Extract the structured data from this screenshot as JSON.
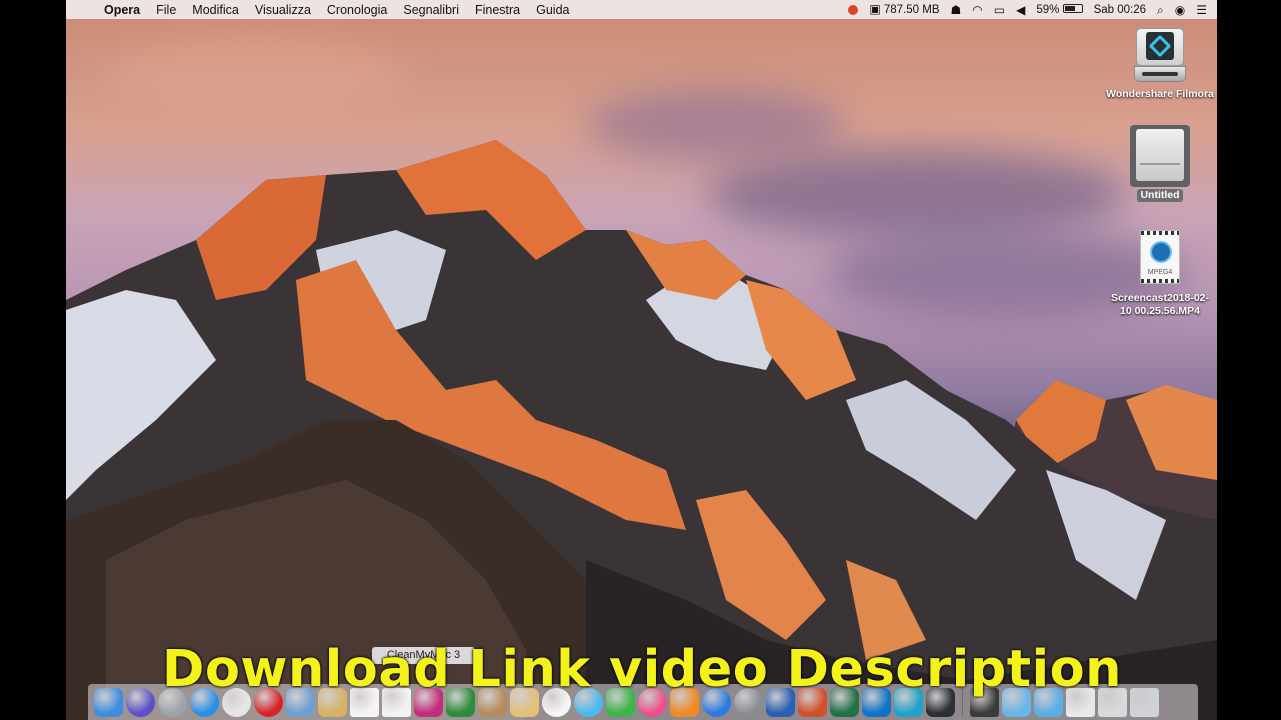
{
  "menubar": {
    "app_name": "Opera",
    "items": [
      "File",
      "Modifica",
      "Visualizza",
      "Cronologia",
      "Segnalibri",
      "Finestra",
      "Guida"
    ],
    "memory": "787.50 MB",
    "battery_percent": "59%",
    "clock": "Sab 00:26"
  },
  "desktop_icons": [
    {
      "label": "Wondershare Filmora",
      "icon": "filmora-drive-icon"
    },
    {
      "label": "Untitled",
      "icon": "external-drive-icon"
    },
    {
      "label": "Screencast2018-02-10 00.25.56.MP4",
      "icon": "mpeg4-file-icon",
      "badge": "MPEG4"
    }
  ],
  "tooltip": "CleanMyMac 3",
  "caption": "Download Link video Description",
  "dock": {
    "apps": [
      {
        "name": "finder",
        "color": "#3a8fe0"
      },
      {
        "name": "siri",
        "color": "#5c4fc8"
      },
      {
        "name": "launchpad",
        "color": "#9ca3ab"
      },
      {
        "name": "safari",
        "color": "#2b8ee6"
      },
      {
        "name": "chrome",
        "color": "#e6e6e6"
      },
      {
        "name": "opera",
        "color": "#d8232a"
      },
      {
        "name": "preview",
        "color": "#6f9ed0"
      },
      {
        "name": "notes-folder",
        "color": "#d6b264"
      },
      {
        "name": "calendar",
        "color": "#f4f4f4"
      },
      {
        "name": "text-edit",
        "color": "#f2f2f2"
      },
      {
        "name": "cleanmymac",
        "color": "#c42c7c"
      },
      {
        "name": "terminal-green",
        "color": "#2f8c3b"
      },
      {
        "name": "contacts",
        "color": "#b48b5d"
      },
      {
        "name": "pencil-app",
        "color": "#e2c07a"
      },
      {
        "name": "photos",
        "color": "#f5f5f5"
      },
      {
        "name": "messages",
        "color": "#4cb8f0"
      },
      {
        "name": "facetime",
        "color": "#3cb54a"
      },
      {
        "name": "itunes",
        "color": "#ee4f8a"
      },
      {
        "name": "ibooks",
        "color": "#f08a24"
      },
      {
        "name": "app-store",
        "color": "#2a7ae4"
      },
      {
        "name": "system-preferences",
        "color": "#8a8d93"
      },
      {
        "name": "word",
        "color": "#2b5fb4"
      },
      {
        "name": "powerpoint",
        "color": "#d2502c"
      },
      {
        "name": "excel",
        "color": "#207245"
      },
      {
        "name": "outlook",
        "color": "#0f74c8"
      },
      {
        "name": "onenote-teal",
        "color": "#1fa3c8"
      },
      {
        "name": "filmora",
        "color": "#2b3036"
      }
    ],
    "folders": [
      {
        "name": "downloads-stack",
        "color": "#3b3b3b"
      },
      {
        "name": "folder-blue",
        "color": "#68b5e8"
      },
      {
        "name": "folder-blue-2",
        "color": "#5aaee6"
      },
      {
        "name": "screenshot-stack",
        "color": "#e8e8e8"
      },
      {
        "name": "documents-stack",
        "color": "#d9d9d9"
      },
      {
        "name": "trash",
        "color": "#cfd3d8"
      }
    ]
  }
}
